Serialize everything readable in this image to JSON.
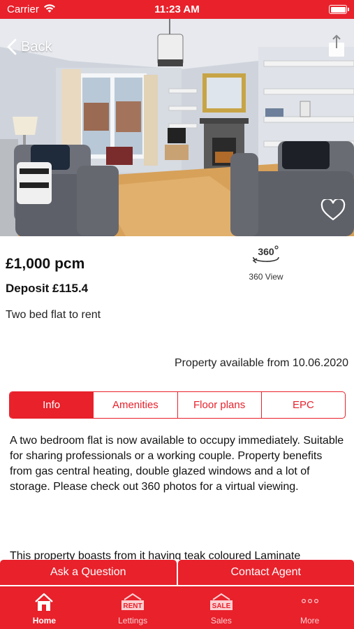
{
  "status_bar": {
    "carrier": "Carrier",
    "time": "11:23 AM"
  },
  "nav": {
    "back_label": "Back"
  },
  "listing": {
    "price": "£1,000 pcm",
    "deposit": "Deposit £115.4",
    "summary": "Two bed flat to rent",
    "view360_label": "360 View",
    "available": "Property available from 10.06.2020"
  },
  "tabs": [
    {
      "label": "Info",
      "active": true
    },
    {
      "label": "Amenities",
      "active": false
    },
    {
      "label": "Floor plans",
      "active": false
    },
    {
      "label": "EPC",
      "active": false
    }
  ],
  "description": {
    "paragraph1": "A two bedroom flat is now available to occupy immediately. Suitable for sharing professionals or a working couple. Property benefits from gas central heating, double glazed windows and a lot of storage. Please check out 360 photos for a virtual viewing.",
    "paragraph2": "This property boasts from it having teak coloured Laminate"
  },
  "actions": {
    "ask_question": "Ask a Question",
    "contact_agent": "Contact Agent"
  },
  "tab_bar": [
    {
      "label": "Home",
      "icon": "home-icon",
      "active": true
    },
    {
      "label": "Lettings",
      "icon": "rent-sign-icon",
      "active": false,
      "badge": "RENT"
    },
    {
      "label": "Sales",
      "icon": "sale-sign-icon",
      "active": false,
      "badge": "SALE"
    },
    {
      "label": "More",
      "icon": "more-dots-icon",
      "active": false
    }
  ],
  "colors": {
    "brand": "#e8212b",
    "text": "#111111"
  }
}
